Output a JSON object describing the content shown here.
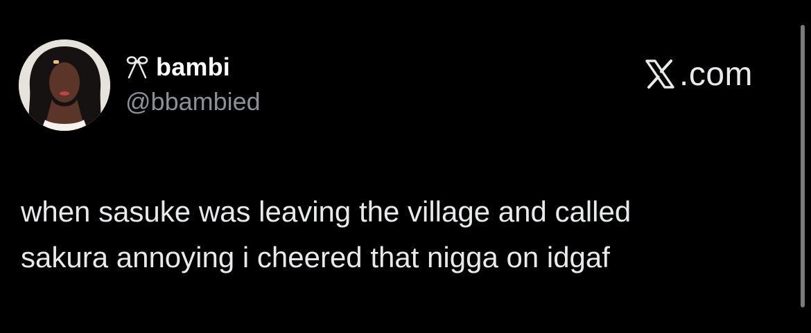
{
  "author": {
    "display_name": "bambi",
    "handle": "@bbambied",
    "name_icon": "bow-ribbon-icon",
    "avatar": "profile-photo"
  },
  "brand": {
    "site_text": ".com",
    "logo_icon": "x-logo-icon"
  },
  "tweet": {
    "lines": [
      "when sasuke was leaving the village and called",
      "sakura annoying i cheered that nigga on idgaf"
    ]
  },
  "colors": {
    "background": "#000000",
    "primary_text": "#e7e9ea",
    "secondary_text": "#8b9096",
    "scrollbar": "#7a7a7a"
  }
}
